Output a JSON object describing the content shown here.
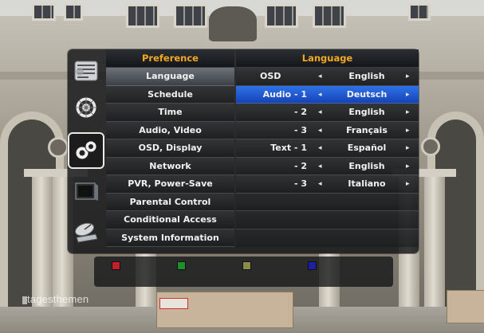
{
  "menu": {
    "left_header": "Preference",
    "right_header": "Language",
    "items": [
      {
        "label": "Language",
        "selected": true
      },
      {
        "label": "Schedule",
        "selected": false
      },
      {
        "label": "Time",
        "selected": false
      },
      {
        "label": "Audio, Video",
        "selected": false
      },
      {
        "label": "OSD, Display",
        "selected": false
      },
      {
        "label": "Network",
        "selected": false
      },
      {
        "label": "PVR, Power-Save",
        "selected": false
      },
      {
        "label": "Parental Control",
        "selected": false
      },
      {
        "label": "Conditional Access",
        "selected": false
      },
      {
        "label": "System Information",
        "selected": false
      }
    ],
    "settings": [
      {
        "label": "OSD",
        "value": "English",
        "active": false
      },
      {
        "label": "Audio - 1",
        "value": "Deutsch",
        "active": true
      },
      {
        "label": "- 2",
        "value": "English",
        "active": false
      },
      {
        "label": "- 3",
        "value": "Français",
        "active": false
      },
      {
        "label": "Text - 1",
        "value": "Español",
        "active": false
      },
      {
        "label": "- 2",
        "value": "English",
        "active": false
      },
      {
        "label": "- 3",
        "value": "Italiano",
        "active": false
      }
    ],
    "arrows": {
      "left": "◂",
      "right": "▸"
    }
  },
  "icons": [
    {
      "name": "program-list-icon"
    },
    {
      "name": "dartboard-icon"
    },
    {
      "name": "audio-settings-icon",
      "active": true
    },
    {
      "name": "tv-screen-icon"
    },
    {
      "name": "satellite-dish-icon"
    }
  ],
  "color_buttons": [
    {
      "name": "red-button",
      "color": "#c0202a"
    },
    {
      "name": "green-button",
      "color": "#1f8f2b"
    },
    {
      "name": "yellow-button",
      "color": "#8a8a4a"
    },
    {
      "name": "blue-button",
      "color": "#1f1fa6"
    }
  ],
  "channel_logo": "tagesthemen",
  "colors": {
    "accent_orange": "#f3a922",
    "selection_blue": "#1f5ed8"
  }
}
